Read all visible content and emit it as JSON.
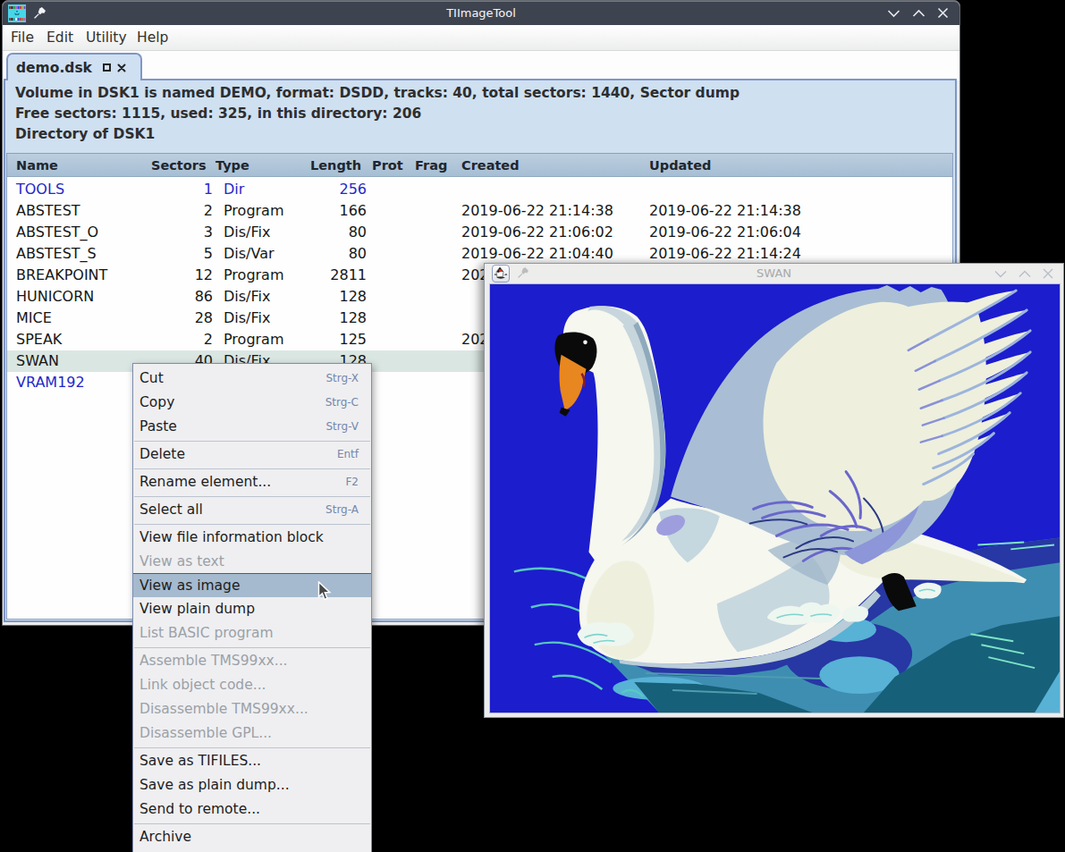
{
  "desktop": {
    "background_color": "#000000"
  },
  "main_window": {
    "title": "TIImageTool",
    "titlebar_icon": "tiimagetool-app-icon",
    "controls": {
      "minimize": "v-chevron",
      "maximize": "^-chevron",
      "close": "x"
    },
    "menubar": {
      "items": [
        "File",
        "Edit",
        "Utility",
        "Help"
      ]
    },
    "tab": {
      "label": "demo.dsk",
      "float_icon": "square",
      "close_icon": "x"
    },
    "info_lines": [
      "Volume in DSK1 is named DEMO, format: DSDD, tracks: 40, total sectors: 1440, Sector dump",
      "Free sectors: 1115, used: 325, in this directory: 206",
      "Directory of DSK1"
    ],
    "table": {
      "columns": [
        "Name",
        "Sectors",
        "Type",
        "Length",
        "Prot",
        "Frag",
        "Created",
        "Updated"
      ],
      "rows": [
        {
          "name": "TOOLS",
          "sectors": "1",
          "type": "Dir",
          "length": "256",
          "prot": "",
          "frag": "",
          "created": "",
          "updated": ""
        },
        {
          "name": "ABSTEST",
          "sectors": "2",
          "type": "Program",
          "length": "166",
          "prot": "",
          "frag": "",
          "created": "2019-06-22 21:14:38",
          "updated": "2019-06-22 21:14:38"
        },
        {
          "name": "ABSTEST_O",
          "sectors": "3",
          "type": "Dis/Fix",
          "length": "80",
          "prot": "",
          "frag": "",
          "created": "2019-06-22 21:06:02",
          "updated": "2019-06-22 21:06:04"
        },
        {
          "name": "ABSTEST_S",
          "sectors": "5",
          "type": "Dis/Var",
          "length": "80",
          "prot": "",
          "frag": "",
          "created": "2019-06-22 21:04:40",
          "updated": "2019-06-22 21:14:24"
        },
        {
          "name": "BREAKPOINT",
          "sectors": "12",
          "type": "Program",
          "length": "2811",
          "prot": "",
          "frag": "",
          "created": "202",
          "updated": ""
        },
        {
          "name": "HUNICORN",
          "sectors": "86",
          "type": "Dis/Fix",
          "length": "128",
          "prot": "",
          "frag": "",
          "created": "",
          "updated": ""
        },
        {
          "name": "MICE",
          "sectors": "28",
          "type": "Dis/Fix",
          "length": "128",
          "prot": "",
          "frag": "",
          "created": "",
          "updated": ""
        },
        {
          "name": "SPEAK",
          "sectors": "2",
          "type": "Program",
          "length": "125",
          "prot": "",
          "frag": "",
          "created": "202",
          "updated": ""
        },
        {
          "name": "SWAN",
          "sectors": "40",
          "type": "Dis/Fix",
          "length": "128",
          "prot": "",
          "frag": "",
          "created": "",
          "updated": ""
        },
        {
          "name": "VRAM192",
          "sectors": "",
          "type": "",
          "length": "",
          "prot": "",
          "frag": "",
          "created": "",
          "updated": ""
        }
      ],
      "selected_row": "SWAN",
      "link_color": "#2328c9",
      "selection_color": "#dae6e2"
    }
  },
  "context_menu": {
    "items": [
      {
        "label": "Cut",
        "shortcut": "Strg-X"
      },
      {
        "label": "Copy",
        "shortcut": "Strg-C"
      },
      {
        "label": "Paste",
        "shortcut": "Strg-V"
      },
      {
        "label": "Delete",
        "shortcut": "Entf"
      },
      {
        "label": "Rename element...",
        "shortcut": "F2"
      },
      {
        "label": "Select all",
        "shortcut": "Strg-A"
      },
      {
        "label": "View file information block",
        "shortcut": ""
      },
      {
        "label": "View as text",
        "shortcut": "",
        "disabled": true
      },
      {
        "label": "View as image",
        "shortcut": "",
        "highlighted": true
      },
      {
        "label": "View plain dump",
        "shortcut": ""
      },
      {
        "label": "List BASIC program",
        "shortcut": "",
        "disabled": true
      },
      {
        "label": "Assemble TMS99xx...",
        "shortcut": "",
        "disabled": true
      },
      {
        "label": "Link object code...",
        "shortcut": "",
        "disabled": true
      },
      {
        "label": "Disassemble TMS99xx...",
        "shortcut": "",
        "disabled": true
      },
      {
        "label": "Disassemble GPL...",
        "shortcut": "",
        "disabled": true
      },
      {
        "label": "Save as TIFILES...",
        "shortcut": ""
      },
      {
        "label": "Save as plain dump...",
        "shortcut": ""
      },
      {
        "label": "Send to remote...",
        "shortcut": ""
      },
      {
        "label": "Archive",
        "shortcut": ""
      }
    ],
    "highlight_color": "#a5bace"
  },
  "swan_window": {
    "title": "SWAN",
    "titlebar_icon": "duke-java-icon",
    "controls": {
      "minimize": "v-chevron",
      "maximize": "^-chevron",
      "close": "x"
    },
    "image_palette": {
      "background_blue": "#1c1dcd",
      "swan_white": "#f6f7ef",
      "cream": "#eef0dd",
      "wing_gray_blue": "#a9bed4",
      "shade_gray": "#c7d6dc",
      "edge_gray": "#8fa9bd",
      "periwinkle": "#8890d8",
      "violet": "#6a66cc",
      "beak_orange": "#e8871f",
      "mouth_red": "#8c1c28",
      "water_teal": "#3e8eb2",
      "water_navy": "#2737a4",
      "water_light": "#57b2d6",
      "water_dark": "#176079",
      "ripple_cyan": "#57c8c2",
      "foam": "#eef6f0",
      "black": "#0a0a0a"
    }
  }
}
